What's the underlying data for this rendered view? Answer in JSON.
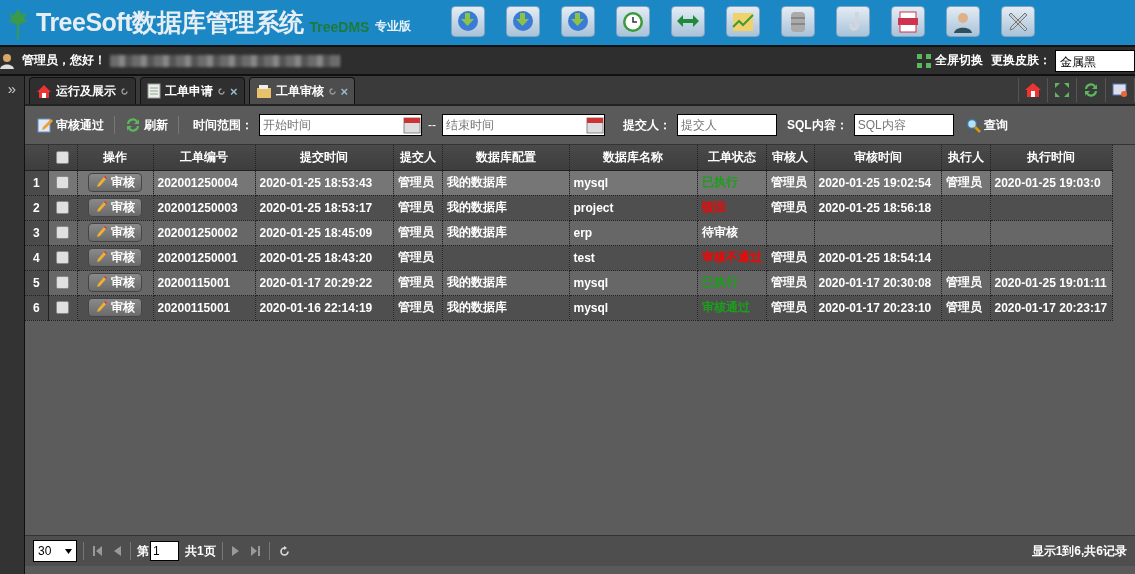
{
  "header": {
    "logo": "TreeSoft数据库管理系统",
    "product": "TreeDMS",
    "edition": "专业版"
  },
  "userbar": {
    "greeting": "管理员，您好！",
    "fullscreen": "全屏切换",
    "skin_label": "更换皮肤：",
    "skin_value": "金属黑"
  },
  "sidebar": {
    "toggle": "»"
  },
  "tabs": [
    {
      "label": "运行及展示",
      "selected": false
    },
    {
      "label": "工单申请",
      "close": "×",
      "selected": false
    },
    {
      "label": "工单审核",
      "close": "×",
      "selected": true
    }
  ],
  "toolbar": {
    "approve": "审核通过",
    "refresh": "刷新",
    "time_label": "时间范围：",
    "start_placeholder": "开始时间",
    "separator": "--",
    "end_placeholder": "结束时间",
    "submitter_label": "提交人：",
    "submitter_placeholder": "提交人",
    "sql_label": "SQL内容：",
    "sql_placeholder": "SQL内容",
    "search": "查询"
  },
  "table": {
    "all_checked": false,
    "columns": [
      "操作",
      "工单编号",
      "提交时间",
      "提交人",
      "数据库配置",
      "数据库名称",
      "工单状态",
      "审核人",
      "审核时间",
      "执行人",
      "执行时间"
    ],
    "rows": [
      {
        "index": "1",
        "checked": false,
        "selected": true,
        "action": "审核",
        "number": "202001250004",
        "submitted": "2020-01-25 18:53:43",
        "submitter": "管理员",
        "db_config": "我的数据库",
        "db_name": "mysql",
        "status": "已执行",
        "color": "#1aa01a",
        "reviewer": "管理员",
        "review_time": "2020-01-25 19:02:54",
        "executor": "管理员",
        "exec_time": "2020-01-25 19:03:0"
      },
      {
        "index": "2",
        "checked": false,
        "selected": false,
        "action": "审核",
        "number": "202001250003",
        "submitted": "2020-01-25 18:53:17",
        "submitter": "管理员",
        "db_config": "我的数据库",
        "db_name": "project",
        "status": "驳回",
        "color": "#ff0000",
        "reviewer": "管理员",
        "review_time": "2020-01-25 18:56:18"
      },
      {
        "index": "3",
        "checked": false,
        "selected": false,
        "action": "审核",
        "number": "202001250002",
        "submitted": "2020-01-25 18:45:09",
        "submitter": "管理员",
        "db_config": "我的数据库",
        "db_name": "erp",
        "status": "待审核",
        "color": "#ffffff"
      },
      {
        "index": "4",
        "checked": false,
        "selected": false,
        "action": "审核",
        "number": "202001250001",
        "submitted": "2020-01-25 18:43:20",
        "submitter": "管理员",
        "db_name": "test",
        "status": "审核不通过",
        "color": "#ff0000",
        "reviewer": "管理员",
        "review_time": "2020-01-25 18:54:14"
      },
      {
        "index": "5",
        "checked": false,
        "selected": false,
        "action": "审核",
        "number": "20200115001",
        "submitted": "2020-01-17 20:29:22",
        "submitter": "管理员",
        "db_config": "我的数据库",
        "db_name": "mysql",
        "status": "已执行",
        "color": "#1aa01a",
        "reviewer": "管理员",
        "review_time": "2020-01-17 20:30:08",
        "executor": "管理员",
        "exec_time": "2020-01-25 19:01:11"
      },
      {
        "index": "6",
        "checked": false,
        "selected": false,
        "action": "审核",
        "number": "20200115001",
        "submitted": "2020-01-16 22:14:19",
        "submitter": "管理员",
        "db_config": "我的数据库",
        "db_name": "mysql",
        "status": "审核通过",
        "color": "#1aa01a",
        "reviewer": "管理员",
        "review_time": "2020-01-17 20:23:10",
        "executor": "管理员",
        "exec_time": "2020-01-17 20:23:17"
      }
    ]
  },
  "pager": {
    "page_size": "30",
    "page_prefix": "第",
    "page": "1",
    "page_total": "共1页",
    "summary": "显示1到6,共6记录"
  }
}
